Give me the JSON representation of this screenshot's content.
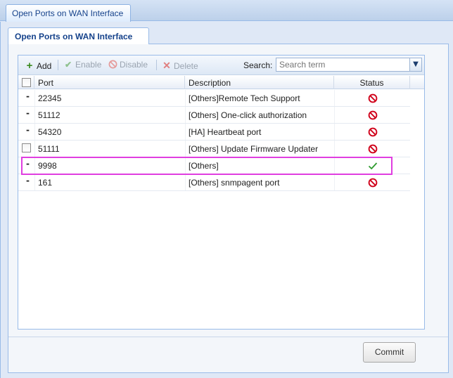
{
  "window": {
    "tab_title": "Open Ports on WAN Interface"
  },
  "panel": {
    "tab_title": "Open Ports on WAN Interface"
  },
  "toolbar": {
    "add_label": "Add",
    "enable_label": "Enable",
    "disable_label": "Disable",
    "delete_label": "Delete",
    "search_label": "Search:",
    "search_placeholder": "Search term"
  },
  "grid": {
    "columns": {
      "port": "Port",
      "description": "Description",
      "status": "Status"
    },
    "rows": [
      {
        "port": "22345",
        "description": "[Others]Remote Tech Support",
        "status": "disabled",
        "selector": "dash"
      },
      {
        "port": "51112",
        "description": "[Others] One-click authorization",
        "status": "disabled",
        "selector": "dash"
      },
      {
        "port": "54320",
        "description": "[HA] Heartbeat port",
        "status": "disabled",
        "selector": "dash"
      },
      {
        "port": "51111",
        "description": "[Others] Update Firmware Updater",
        "status": "disabled",
        "selector": "checkbox"
      },
      {
        "port": "9998",
        "description": "[Others]",
        "status": "enabled",
        "selector": "dash"
      },
      {
        "port": "161",
        "description": "[Others] snmpagent port",
        "status": "disabled",
        "selector": "dash"
      }
    ]
  },
  "footer": {
    "commit_label": "Commit"
  },
  "colors": {
    "add_icon": "#3a8a1e",
    "disabled_icon": "#d0021b",
    "enabled_icon": "#2e9a2e",
    "highlight": "#e03ee0",
    "muted_text": "#9aa4b0"
  }
}
